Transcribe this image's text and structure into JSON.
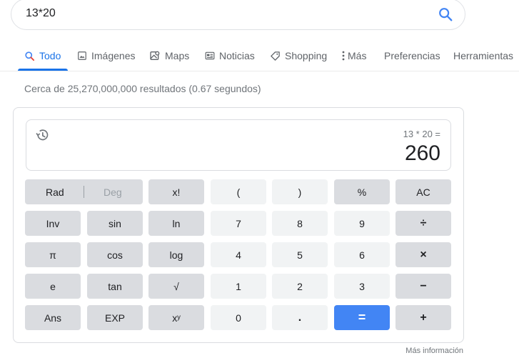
{
  "search": {
    "query": "13*20"
  },
  "tabs": [
    {
      "label": "Todo",
      "icon": "search-icon",
      "active": true
    },
    {
      "label": "Imágenes",
      "icon": "image-icon"
    },
    {
      "label": "Maps",
      "icon": "map-icon"
    },
    {
      "label": "Noticias",
      "icon": "news-icon"
    },
    {
      "label": "Shopping",
      "icon": "tag-icon"
    },
    {
      "label": "Más",
      "icon": "more-vert-icon"
    },
    {
      "label": "Preferencias"
    },
    {
      "label": "Herramientas"
    }
  ],
  "result_stats": "Cerca de 25,270,000,000 resultados (0.67 segundos)",
  "calculator": {
    "expression": "13 * 20 =",
    "result": "260",
    "rad_label": "Rad",
    "deg_label": "Deg",
    "angle_mode": "Rad",
    "keys": {
      "fact": "x!",
      "lparen": "(",
      "rparen": ")",
      "percent": "%",
      "ac": "AC",
      "inv": "Inv",
      "sin": "sin",
      "ln": "ln",
      "d7": "7",
      "d8": "8",
      "d9": "9",
      "divide": "÷",
      "pi": "π",
      "cos": "cos",
      "log": "log",
      "d4": "4",
      "d5": "5",
      "d6": "6",
      "multiply": "×",
      "e": "e",
      "tan": "tan",
      "sqrt": "√",
      "d1": "1",
      "d2": "2",
      "d3": "3",
      "minus": "−",
      "ans": "Ans",
      "exp": "EXP",
      "pow": "xʸ",
      "d0": "0",
      "dot": ".",
      "equals": "=",
      "plus": "+"
    },
    "more_info": "Más información"
  },
  "colors": {
    "accent": "#1a73e8",
    "equals_button": "#4285f4",
    "operator_button": "#dadce0",
    "number_button": "#f1f3f4"
  }
}
